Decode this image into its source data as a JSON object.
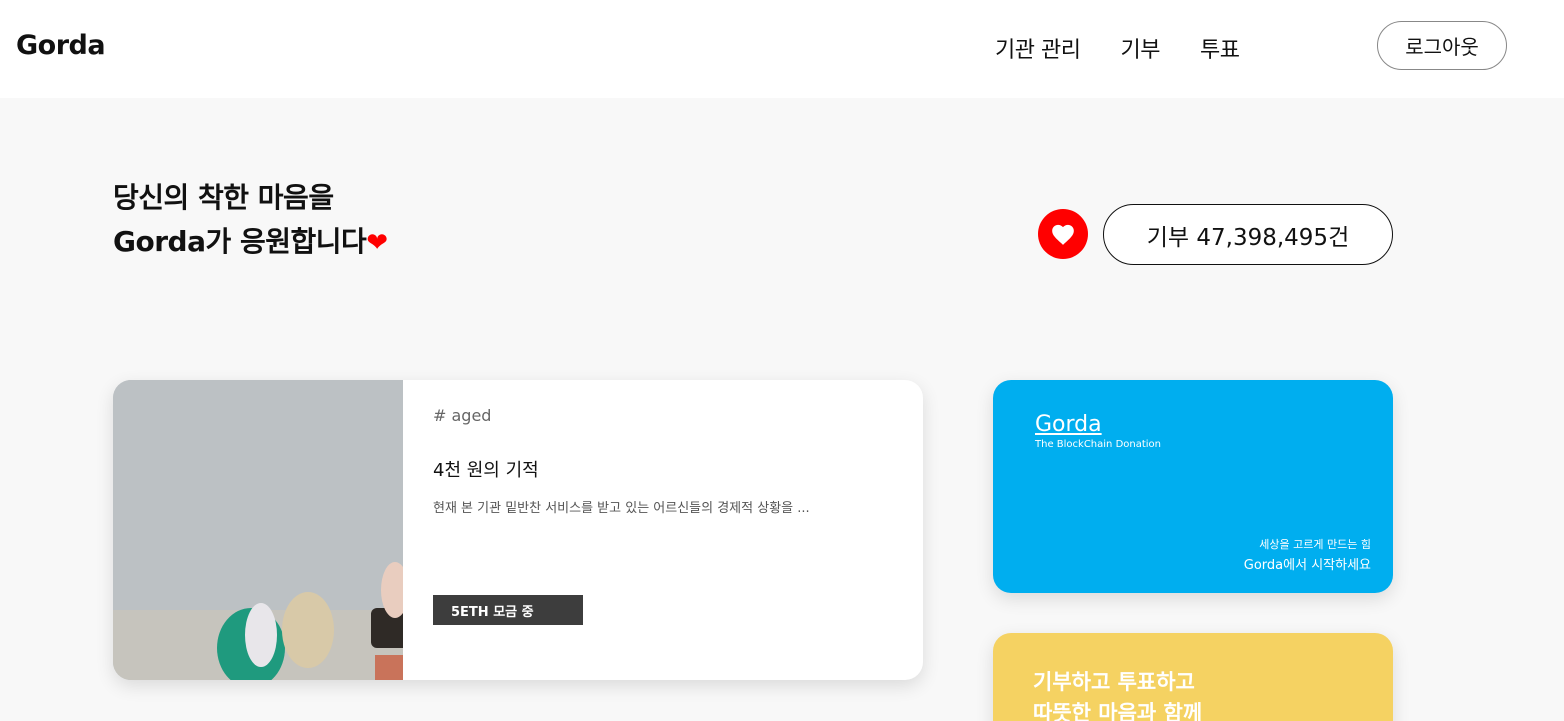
{
  "header": {
    "logo": "Gorda",
    "nav": [
      "기관 관리",
      "기부",
      "투표"
    ],
    "logout_label": "로그아웃"
  },
  "hero": {
    "line1": "당신의 착한 마음을",
    "line2": "Gorda가 응원합니다",
    "heart": "❤",
    "donation_count": "기부 47,398,495건"
  },
  "campaign": {
    "tag": "# aged",
    "title": "4천 원의 기적",
    "description": "현재 본 기관 밑반찬 서비스를 받고 있는 어르신들의 경제적 상황을 ...",
    "status": "5ETH 모금 중"
  },
  "blue_card": {
    "brand": "Gorda",
    "subtitle": "The BlockChain Donation",
    "line1": "세상을 고르게 만드는 힘",
    "line2": "Gorda에서 시작하세요"
  },
  "yellow_card": {
    "line1": "기부하고 투표하고",
    "line2": "따뜻한 마음과 함께"
  },
  "colors": {
    "accent_red": "#ff0000",
    "card_blue": "#00aeef",
    "card_yellow": "#f5d262",
    "status_bg": "#3d3d3d"
  }
}
